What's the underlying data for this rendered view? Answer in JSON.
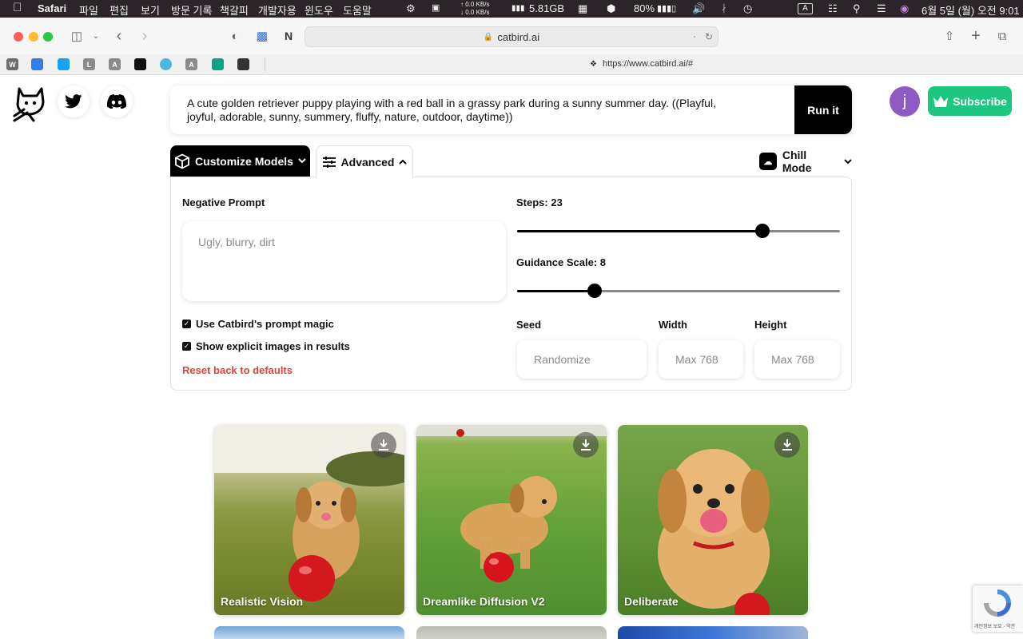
{
  "menubar": {
    "app": "Safari",
    "items": [
      "파일",
      "편집",
      "보기",
      "방문 기록",
      "책갈피",
      "개발자용",
      "윈도우",
      "도움말"
    ],
    "net_up": "↑ 0.0 KB/s",
    "net_down": "↓ 0.0 KB/s",
    "memory": "5.81GB",
    "battery": "80%",
    "datetime": "6월 5일 (월) 오전 9:01",
    "input_indicator": "A"
  },
  "browser": {
    "url": "catbird.ai",
    "hover_url": "https://www.catbird.ai/#",
    "favorites": [
      {
        "glyph": "W",
        "color": "#6c6c6c"
      },
      {
        "glyph": "",
        "color": "#2f7fe6"
      },
      {
        "glyph": "",
        "color": "#1da1f2"
      },
      {
        "glyph": "L",
        "color": "#8a8a8a"
      },
      {
        "glyph": "A",
        "color": "#8a8a8a"
      },
      {
        "glyph": "",
        "color": "#111111"
      },
      {
        "glyph": "",
        "color": "#4ab8e0"
      },
      {
        "glyph": "A",
        "color": "#8a8a8a"
      },
      {
        "glyph": "",
        "color": "#10a37f"
      },
      {
        "glyph": "",
        "color": "#333333"
      }
    ]
  },
  "header": {
    "prompt": "A cute golden retriever puppy playing with a red ball in a grassy park during a sunny summer day. ((Playful, joyful, adorable, sunny, summery, fluffy, nature, outdoor, daytime))",
    "run_label": "Run it",
    "avatar_letter": "j",
    "subscribe_label": "Subscribe"
  },
  "tabs": {
    "customize_label": "Customize Models",
    "advanced_label": "Advanced",
    "mode_label": "Chill Mode"
  },
  "advanced": {
    "negative_label": "Negative Prompt",
    "negative_placeholder": "Ugly, blurry, dirt",
    "prompt_magic_label": "Use Catbird's prompt magic",
    "prompt_magic_checked": true,
    "explicit_label": "Show explicit images in results",
    "explicit_checked": true,
    "reset_label": "Reset back to defaults",
    "steps_label": "Steps: 23",
    "steps_fraction": 0.76,
    "guidance_label": "Guidance Scale: 8",
    "guidance_fraction": 0.24,
    "seed_label": "Seed",
    "seed_placeholder": "Randomize",
    "width_label": "Width",
    "width_placeholder": "Max 768",
    "height_label": "Height",
    "height_placeholder": "Max 768"
  },
  "results": [
    {
      "model": "Realistic Vision"
    },
    {
      "model": "Dreamlike Diffusion V2"
    },
    {
      "model": "Deliberate"
    }
  ],
  "recaptcha": {
    "text": "개인정보 보호 - 약관"
  },
  "colors": {
    "accent_green": "#1dc77f",
    "reset_red": "#e0423a",
    "avatar_purple": "#8e5bc4"
  }
}
